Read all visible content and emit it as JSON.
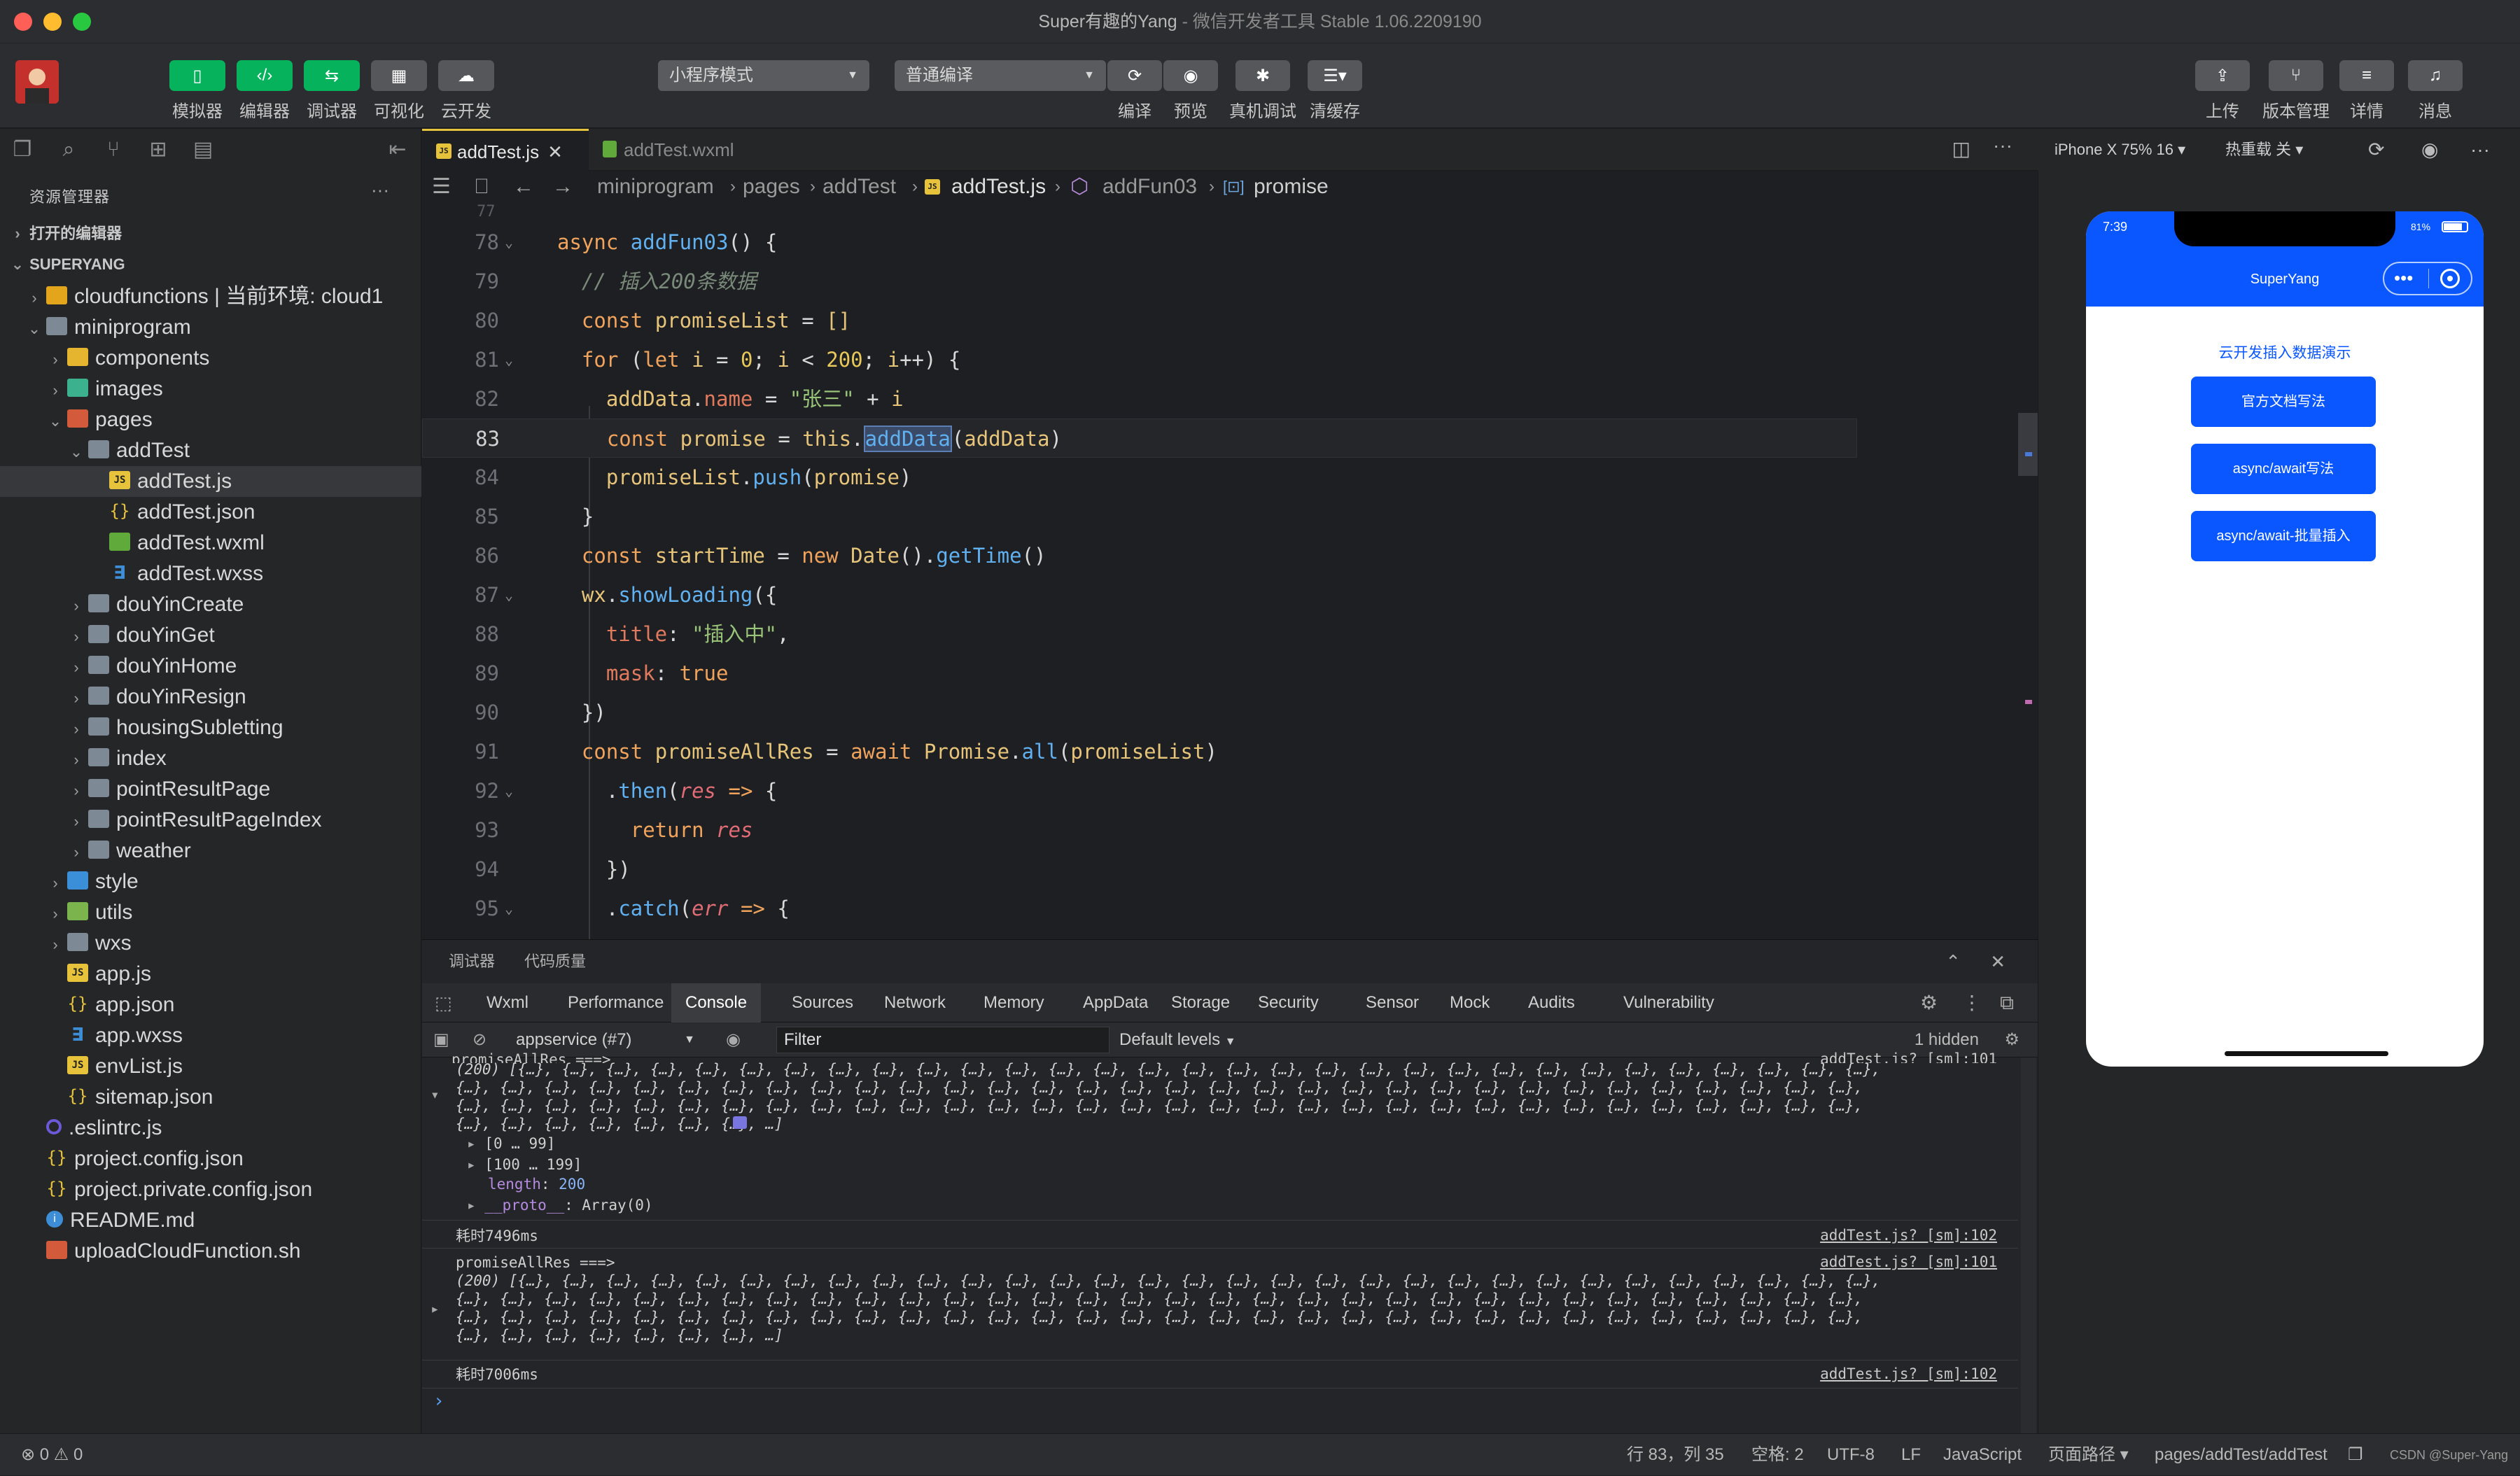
{
  "window": {
    "title_main": "Super有趣的Yang",
    "title_sub": " - 微信开发者工具 Stable 1.06.2209190"
  },
  "toolbar": {
    "simulator": "模拟器",
    "editor": "编辑器",
    "debugger": "调试器",
    "visual": "可视化",
    "cloud": "云开发",
    "mode_select": "小程序模式",
    "compile_select": "普通编译",
    "compile": "编译",
    "preview": "预览",
    "real_debug": "真机调试",
    "clear_cache": "清缓存",
    "upload": "上传",
    "version": "版本管理",
    "details": "详情",
    "messages": "消息"
  },
  "explorer": {
    "title": "资源管理器",
    "more": "···",
    "open_editors": "打开的编辑器",
    "project": "SUPERYANG",
    "items": [
      {
        "label": "cloudfunctions | 当前环境: cloud1",
        "depth": 1,
        "chev": "›",
        "icon": "f-cloud"
      },
      {
        "label": "miniprogram",
        "depth": 1,
        "chev": "⌄",
        "icon": "f-folder"
      },
      {
        "label": "components",
        "depth": 2,
        "chev": "›",
        "icon": "f-yellow"
      },
      {
        "label": "images",
        "depth": 2,
        "chev": "›",
        "icon": "f-img"
      },
      {
        "label": "pages",
        "depth": 2,
        "chev": "⌄",
        "icon": "f-pages"
      },
      {
        "label": "addTest",
        "depth": 3,
        "chev": "⌄",
        "icon": "f-folder"
      },
      {
        "label": "addTest.js",
        "depth": 4,
        "chev": "",
        "icon": "f-js",
        "sel": true
      },
      {
        "label": "addTest.json",
        "depth": 4,
        "chev": "",
        "icon": "f-json"
      },
      {
        "label": "addTest.wxml",
        "depth": 4,
        "chev": "",
        "icon": "f-wxml"
      },
      {
        "label": "addTest.wxss",
        "depth": 4,
        "chev": "",
        "icon": "f-wxss"
      },
      {
        "label": "douYinCreate",
        "depth": 3,
        "chev": "›",
        "icon": "f-folder"
      },
      {
        "label": "douYinGet",
        "depth": 3,
        "chev": "›",
        "icon": "f-folder"
      },
      {
        "label": "douYinHome",
        "depth": 3,
        "chev": "›",
        "icon": "f-folder"
      },
      {
        "label": "douYinResign",
        "depth": 3,
        "chev": "›",
        "icon": "f-folder"
      },
      {
        "label": "housingSubletting",
        "depth": 3,
        "chev": "›",
        "icon": "f-folder"
      },
      {
        "label": "index",
        "depth": 3,
        "chev": "›",
        "icon": "f-folder"
      },
      {
        "label": "pointResultPage",
        "depth": 3,
        "chev": "›",
        "icon": "f-folder"
      },
      {
        "label": "pointResultPageIndex",
        "depth": 3,
        "chev": "›",
        "icon": "f-folder"
      },
      {
        "label": "weather",
        "depth": 3,
        "chev": "›",
        "icon": "f-folder"
      },
      {
        "label": "style",
        "depth": 2,
        "chev": "›",
        "icon": "f-style"
      },
      {
        "label": "utils",
        "depth": 2,
        "chev": "›",
        "icon": "f-utils"
      },
      {
        "label": "wxs",
        "depth": 2,
        "chev": "›",
        "icon": "f-folder"
      },
      {
        "label": "app.js",
        "depth": 2,
        "chev": "",
        "icon": "f-js"
      },
      {
        "label": "app.json",
        "depth": 2,
        "chev": "",
        "icon": "f-json"
      },
      {
        "label": "app.wxss",
        "depth": 2,
        "chev": "",
        "icon": "f-wxss"
      },
      {
        "label": "envList.js",
        "depth": 2,
        "chev": "",
        "icon": "f-js"
      },
      {
        "label": "sitemap.json",
        "depth": 2,
        "chev": "",
        "icon": "f-json"
      },
      {
        "label": ".eslintrc.js",
        "depth": 1,
        "chev": "",
        "icon": "f-eslint"
      },
      {
        "label": "project.config.json",
        "depth": 1,
        "chev": "",
        "icon": "f-json"
      },
      {
        "label": "project.private.config.json",
        "depth": 1,
        "chev": "",
        "icon": "f-json"
      },
      {
        "label": "README.md",
        "depth": 1,
        "chev": "",
        "icon": "f-info"
      },
      {
        "label": "uploadCloudFunction.sh",
        "depth": 1,
        "chev": "",
        "icon": "f-sh"
      }
    ]
  },
  "tabs": [
    {
      "label": "addTest.js",
      "active": true
    },
    {
      "label": "addTest.wxml",
      "active": false
    }
  ],
  "breadcrumb": [
    "miniprogram",
    "pages",
    "addTest",
    "addTest.js",
    "addFun03",
    "promise"
  ],
  "code": {
    "current_line": 83,
    "lines": [
      {
        "n": 78,
        "fold": true,
        "html": "<span class='kw'>async</span> <span class='fn'>addFun03</span><span class='pn'>() {</span>"
      },
      {
        "n": 79,
        "fold": false,
        "html": "  <span class='cmt'>// 插入200条数据</span>"
      },
      {
        "n": 80,
        "fold": false,
        "html": "  <span class='kw'>const</span> <span class='var'>promiseList</span> <span class='pn'>=</span> <span class='var'>[]</span>"
      },
      {
        "n": 81,
        "fold": true,
        "html": "  <span class='kw'>for</span> <span class='pn'>(</span><span class='kw'>let</span> <span class='var'>i</span> <span class='pn'>=</span> <span class='num'>0</span><span class='pn'>;</span> <span class='var'>i</span> <span class='pn'>&lt;</span> <span class='num'>200</span><span class='pn'>;</span> <span class='var'>i</span><span class='pn'>++) {</span>"
      },
      {
        "n": 82,
        "fold": false,
        "html": "    <span class='var'>addData</span><span class='pn'>.</span><span class='prop'>name</span> <span class='pn'>=</span> <span class='str'>\"张三\"</span> <span class='pn'>+</span> <span class='var'>i</span>"
      },
      {
        "n": 83,
        "fold": false,
        "html": "    <span class='kw'>const</span> <span class='var'>promise</span> <span class='pn'>=</span> <span class='var'>this</span><span class='pn'>.</span><span class='fn hl'>addData</span><span class='pn'>(</span><span class='var'>addData</span><span class='pn'>)</span>"
      },
      {
        "n": 84,
        "fold": false,
        "html": "    <span class='var'>promiseList</span><span class='pn'>.</span><span class='fn'>push</span><span class='pn'>(</span><span class='var'>promise</span><span class='pn'>)</span>"
      },
      {
        "n": 85,
        "fold": false,
        "html": "  <span class='pn'>}</span>"
      },
      {
        "n": 86,
        "fold": false,
        "html": "  <span class='kw'>const</span> <span class='var'>startTime</span> <span class='pn'>=</span> <span class='kw'>new</span> <span class='var'>Date</span><span class='pn'>().</span><span class='fn'>getTime</span><span class='pn'>()</span>"
      },
      {
        "n": 87,
        "fold": true,
        "html": "  <span class='var'>wx</span><span class='pn'>.</span><span class='fn'>showLoading</span><span class='pn'>({</span>"
      },
      {
        "n": 88,
        "fold": false,
        "html": "    <span class='prop'>title</span><span class='pn'>:</span> <span class='str'>\"插入中\"</span><span class='pn'>,</span>"
      },
      {
        "n": 89,
        "fold": false,
        "html": "    <span class='prop'>mask</span><span class='pn'>:</span> <span class='kw'>true</span>"
      },
      {
        "n": 90,
        "fold": false,
        "html": "  <span class='pn'>})</span>"
      },
      {
        "n": 91,
        "fold": false,
        "html": "  <span class='kw'>const</span> <span class='var'>promiseAllRes</span> <span class='pn'>=</span> <span class='kw'>await</span> <span class='var'>Promise</span><span class='pn'>.</span><span class='fn'>all</span><span class='pn'>(</span><span class='var'>promiseList</span><span class='pn'>)</span>"
      },
      {
        "n": 92,
        "fold": true,
        "html": "    <span class='pn'>.</span><span class='fn'>then</span><span class='pn'>(</span><span class='prm'>res</span> <span class='kw'>=&gt;</span> <span class='pn'>{</span>"
      },
      {
        "n": 93,
        "fold": false,
        "html": "      <span class='kw'>return</span> <span class='prm'>res</span>"
      },
      {
        "n": 94,
        "fold": false,
        "html": "    <span class='pn'>})</span>"
      },
      {
        "n": 95,
        "fold": true,
        "html": "    <span class='pn'>.</span><span class='fn'>catch</span><span class='pn'>(</span><span class='prm'>err</span> <span class='kw'>=&gt;</span> <span class='pn'>{</span>"
      }
    ]
  },
  "devtools": {
    "top_tabs": [
      "调试器",
      "代码质量"
    ],
    "tabs": [
      "Wxml",
      "Performance",
      "Console",
      "Sources",
      "Network",
      "Memory",
      "AppData",
      "Storage",
      "Security",
      "Sensor",
      "Mock",
      "Audits",
      "Vulnerability"
    ],
    "active_tab": "Console",
    "context": "appservice (#7)",
    "filter_placeholder": "Filter",
    "levels": "Default levels",
    "hidden": "1 hidden",
    "console": {
      "block1_label": "promiseAllRes ===>",
      "block1_source": "addTest.js? [sm]:101",
      "block1_lines": [
        "(200) [{…}, {…}, {…}, {…}, {…}, {…}, {…}, {…}, {…}, {…}, {…}, {…}, {…}, {…}, {…}, {…}, {…}, {…}, {…}, {…}, {…}, {…}, {…}, {…}, {…}, {…}, {…}, {…}, {…}, {…}, {…},",
        "{…}, {…}, {…}, {…}, {…}, {…}, {…}, {…}, {…}, {…}, {…}, {…}, {…}, {…}, {…}, {…}, {…}, {…}, {…}, {…}, {…}, {…}, {…}, {…}, {…}, {…}, {…}, {…}, {…}, {…}, {…}, {…},",
        "{…}, {…}, {…}, {…}, {…}, {…}, {…}, {…}, {…}, {…}, {…}, {…}, {…}, {…}, {…}, {…}, {…}, {…}, {…}, {…}, {…}, {…}, {…}, {…}, {…}, {…}, {…}, {…}, {…}, {…}, {…}, {…},",
        "{…}, {…}, {…}, {…}, {…}, {…}, {…}, …]"
      ],
      "range1": "[0 … 99]",
      "range2": "[100 … 199]",
      "length_key": "length",
      "length_val": "200",
      "proto_key": "__proto__",
      "proto_val": "Array(0)",
      "time1": "耗时7496ms",
      "time1_source": "addTest.js? [sm]:102",
      "block2_label": "promiseAllRes ===>",
      "block2_source": "addTest.js? [sm]:101",
      "block2_lines": [
        "(200) [{…}, {…}, {…}, {…}, {…}, {…}, {…}, {…}, {…}, {…}, {…}, {…}, {…}, {…}, {…}, {…}, {…}, {…}, {…}, {…}, {…}, {…}, {…}, {…}, {…}, {…}, {…}, {…}, {…}, {…}, {…},",
        "{…}, {…}, {…}, {…}, {…}, {…}, {…}, {…}, {…}, {…}, {…}, {…}, {…}, {…}, {…}, {…}, {…}, {…}, {…}, {…}, {…}, {…}, {…}, {…}, {…}, {…}, {…}, {…}, {…}, {…}, {…}, {…},",
        "{…}, {…}, {…}, {…}, {…}, {…}, {…}, {…}, {…}, {…}, {…}, {…}, {…}, {…}, {…}, {…}, {…}, {…}, {…}, {…}, {…}, {…}, {…}, {…}, {…}, {…}, {…}, {…}, {…}, {…}, {…}, {…},",
        "{…}, {…}, {…}, {…}, {…}, {…}, {…}, …]"
      ],
      "time2": "耗时7006ms",
      "time2_source": "addTest.js? [sm]:102",
      "prompt": "›"
    }
  },
  "simulator": {
    "device": "iPhone X 75% 16 ▾",
    "hot_reload": "热重载 关 ▾",
    "time": "7:39",
    "battery": "81%",
    "nav_title": "SuperYang",
    "page_title": "云开发插入数据演示",
    "buttons": [
      "官方文档写法",
      "async/await写法",
      "async/await-批量插入"
    ]
  },
  "statusbar": {
    "errors": "⊗ 0 ⚠ 0",
    "position": "行 83，列 35",
    "spaces": "空格: 2",
    "encoding": "UTF-8",
    "eol": "LF",
    "language": "JavaScript",
    "page_path_label": "页面路径 ▾",
    "page_path": "pages/addTest/addTest",
    "watermark": "CSDN @Super-Yang"
  },
  "colors": {
    "accent_green": "#07b25c",
    "wechat_blue": "#0a57ff"
  }
}
